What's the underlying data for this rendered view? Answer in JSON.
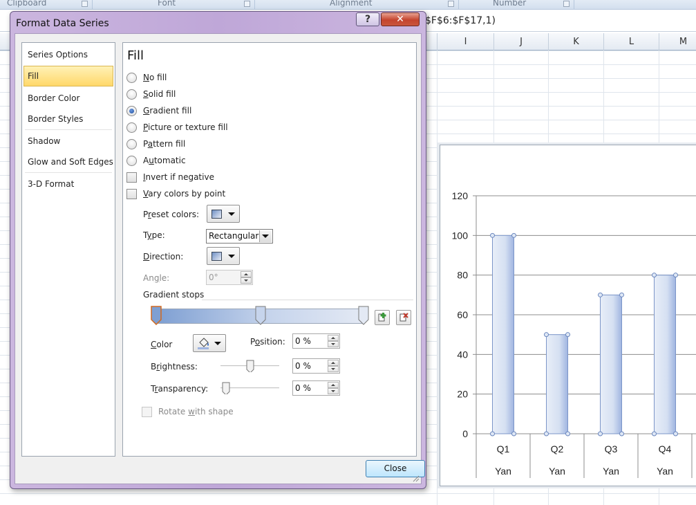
{
  "excel": {
    "ribbon_groups": [
      "Clipboard",
      "Font",
      "Alignment",
      "Number"
    ],
    "formula_visible": "$F$6:$F$17,1)",
    "columns": [
      "I",
      "J",
      "K",
      "L",
      "M"
    ]
  },
  "dialog": {
    "title": "Format Data Series",
    "help_label": "?",
    "close_x_label": "✕",
    "nav_items": [
      "Series Options",
      "Fill",
      "Border Color",
      "Border Styles",
      "Shadow",
      "Glow and Soft Edges",
      "3-D Format"
    ],
    "selected_nav": "Fill",
    "section_title": "Fill",
    "fill_options": [
      {
        "label": "No fill",
        "checked": false
      },
      {
        "label": "Solid fill",
        "checked": false
      },
      {
        "label": "Gradient fill",
        "checked": true
      },
      {
        "label": "Picture or texture fill",
        "checked": false
      },
      {
        "label": "Pattern fill",
        "checked": false
      },
      {
        "label": "Automatic",
        "checked": false
      }
    ],
    "checkboxes": [
      {
        "label": "Invert if negative",
        "checked": false
      },
      {
        "label": "Vary colors by point",
        "checked": false
      }
    ],
    "preset_colors_label": "Preset colors:",
    "type_label": "Type:",
    "type_value": "Rectangular",
    "direction_label": "Direction:",
    "angle_label": "Angle:",
    "angle_value": "0°",
    "gradient_stops_label": "Gradient stops",
    "color_label": "Color",
    "position_label": "Position:",
    "position_value": "0 %",
    "brightness_label": "Brightness:",
    "brightness_value": "0 %",
    "transparency_label": "Transparency:",
    "transparency_value": "0 %",
    "rotate_label": "Rotate with shape",
    "close_button_label": "Close",
    "colors": {
      "accent_selected": "#ffd86a",
      "gradient_start": "#7e9fd2",
      "gradient_end": "#e3e9f4"
    }
  },
  "chart_data": {
    "type": "bar",
    "categories": [
      "Q1",
      "Q2",
      "Q3",
      "Q4"
    ],
    "category_group": "Yan",
    "values": [
      100,
      50,
      70,
      80
    ],
    "ylim": [
      0,
      120
    ],
    "yticks": [
      0,
      20,
      40,
      60,
      80,
      100,
      120
    ],
    "grid": true,
    "bar_fill": "gradient",
    "colors": {
      "bar_edge": "#7b95c8",
      "bar_light": "#e8eef8",
      "bar_dark": "#9fb4e0"
    }
  }
}
